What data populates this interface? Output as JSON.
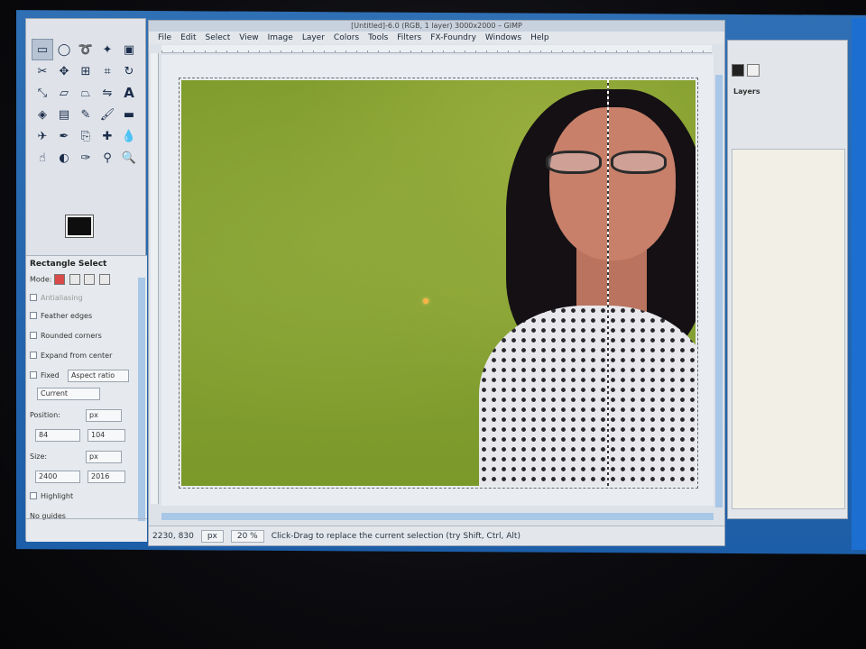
{
  "window": {
    "title": "[Untitled]-6.0 (RGB, 1 layer) 3000x2000 – GIMP"
  },
  "menubar": [
    "File",
    "Edit",
    "Select",
    "View",
    "Image",
    "Layer",
    "Colors",
    "Tools",
    "Filters",
    "FX-Foundry",
    "Windows",
    "Help"
  ],
  "tool_options": {
    "title": "Rectangle Select",
    "mode_label": "Mode:",
    "antialiasing": "Antialiasing",
    "feather_edges": "Feather edges",
    "rounded_corners": "Rounded corners",
    "expand_from_center": "Expand from center",
    "fixed_label": "Fixed",
    "fixed_value": "Aspect ratio",
    "current_value": "Current",
    "position_label": "Position:",
    "position_unit": "px",
    "position_x": "84",
    "position_y": "104",
    "size_label": "Size:",
    "size_unit": "px",
    "size_w": "2400",
    "size_h": "2016",
    "highlight": "Highlight",
    "guides": "No guides"
  },
  "statusbar": {
    "coords": "2230, 830",
    "unit": "px",
    "zoom": "20 %",
    "message": "Click-Drag to replace the current selection (try Shift, Ctrl, Alt)"
  },
  "dock": {
    "title": "Layers"
  },
  "colors": {
    "accent": "#1d5ea8",
    "scroll": "#a9c7e6",
    "foreground": "#0e0e0e",
    "background": "#f3f3f3"
  },
  "icons": [
    "rect-select-icon",
    "ellipse-select-icon",
    "lasso-icon",
    "fuzzy-select-icon",
    "color-select-icon",
    "scissors-icon",
    "move-icon",
    "align-icon",
    "crop-icon",
    "rotate-icon",
    "scale-icon",
    "shear-icon",
    "perspective-icon",
    "flip-icon",
    "text-icon",
    "bucket-fill-icon",
    "gradient-icon",
    "pencil-icon",
    "brush-icon",
    "eraser-icon",
    "airbrush-icon",
    "ink-icon",
    "clone-icon",
    "heal-icon",
    "blur-icon",
    "smudge-icon",
    "dodge-icon",
    "path-icon",
    "color-picker-icon",
    "zoom-icon"
  ]
}
